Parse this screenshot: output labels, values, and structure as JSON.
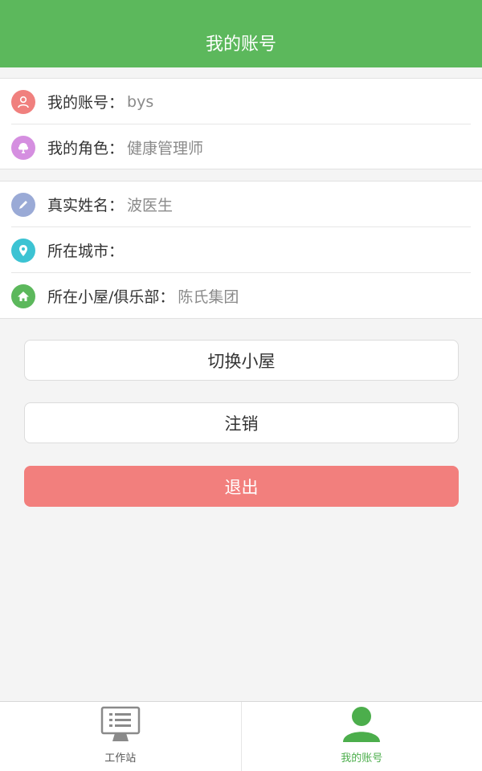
{
  "header": {
    "title": "我的账号"
  },
  "account_group": {
    "items": [
      {
        "icon": "user-icon",
        "color": "#f0807e",
        "label": "我的账号：",
        "value": "bys"
      },
      {
        "icon": "role-icon",
        "color": "#d58fe0",
        "label": "我的角色：",
        "value": "健康管理师"
      }
    ]
  },
  "profile_group": {
    "items": [
      {
        "icon": "pen-icon",
        "color": "#9aaad6",
        "label": "真实姓名：",
        "value": "波医生"
      },
      {
        "icon": "location-pin-icon",
        "color": "#3cc3d3",
        "label": "所在城市：",
        "value": ""
      },
      {
        "icon": "home-icon",
        "color": "#5cb85c",
        "label": "所在小屋/俱乐部：",
        "value": "陈氏集团"
      }
    ]
  },
  "buttons": {
    "switch_label": "切换小屋",
    "cancel_label": "注销",
    "exit_label": "退出"
  },
  "tabbar": {
    "tabs": [
      {
        "icon": "monitor-list-icon",
        "label": "工作站",
        "active": false
      },
      {
        "icon": "person-icon",
        "label": "我的账号",
        "active": true
      }
    ]
  },
  "colors": {
    "brand_green": "#5cb85c",
    "exit_red": "#f27f7d",
    "background": "#f4f4f4"
  }
}
